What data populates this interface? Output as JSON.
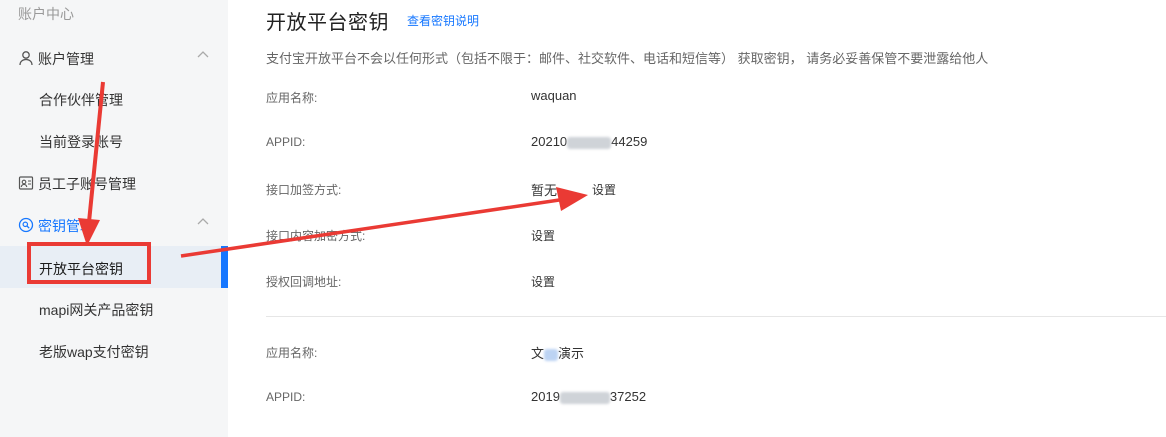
{
  "sidebar": {
    "header": "账户中心",
    "groups": [
      {
        "label": "账户管理",
        "icon": "user-icon"
      },
      {
        "label": "员工子账号管理",
        "icon": "staff-card-icon"
      },
      {
        "label": "密钥管理",
        "icon": "key-search-icon"
      }
    ],
    "items": [
      {
        "label": "合作伙伴管理"
      },
      {
        "label": "当前登录账号"
      },
      {
        "label": "开放平台密钥",
        "active": true
      },
      {
        "label": "mapi网关产品密钥"
      },
      {
        "label": "老版wap支付密钥"
      }
    ]
  },
  "main": {
    "title": "开放平台密钥",
    "title_link": "查看密钥说明",
    "notice": "支付宝开放平台不会以任何形式（包括不限于：邮件、社交软件、电话和短信等） 获取密钥， 请务必妥善保管不要泄露给他人",
    "apps": [
      {
        "rows": [
          {
            "label": "应用名称:",
            "value": "waquan"
          },
          {
            "label": "APPID:",
            "value_prefix": "20210",
            "value_suffix": "44259"
          },
          {
            "label": "接口加签方式:",
            "value": "暂无",
            "action": "设置"
          },
          {
            "label": "接口内容加密方式:",
            "action": "设置"
          },
          {
            "label": "授权回调地址:",
            "action": "设置"
          }
        ]
      },
      {
        "rows": [
          {
            "label": "应用名称:",
            "value_prefix": "文",
            "value_suffix": "演示"
          },
          {
            "label": "APPID:",
            "value_prefix": "2019",
            "value_suffix": "37252"
          }
        ]
      }
    ]
  },
  "colors": {
    "accent": "#1677ff",
    "annotation": "#ea3a34",
    "sidebar_bg": "#f5f6f7"
  }
}
